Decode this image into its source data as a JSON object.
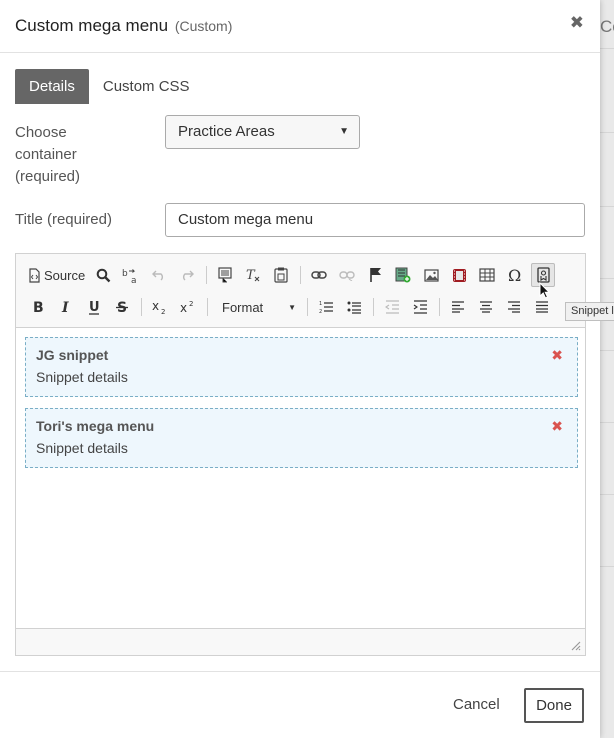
{
  "background": {
    "text": "Co"
  },
  "modal": {
    "title": "Custom mega menu",
    "subtitle": "(Custom)",
    "close": "✖"
  },
  "tabs": [
    {
      "label": "Details",
      "active": true
    },
    {
      "label": "Custom CSS",
      "active": false
    }
  ],
  "form": {
    "container_label_1": "Choose",
    "container_label_2": "container",
    "container_label_3": "(required)",
    "container_value": "Practice Areas",
    "title_label": "Title (required)",
    "title_value": "Custom mega menu"
  },
  "toolbar": {
    "source_label": "Source",
    "format_label": "Format",
    "tooltip": "Snippet link"
  },
  "snippets": [
    {
      "title": "JG snippet",
      "details": "Snippet details",
      "remove": "✖"
    },
    {
      "title": "Tori's mega menu",
      "details": "Snippet details",
      "remove": "✖"
    }
  ],
  "footer": {
    "cancel": "Cancel",
    "done": "Done"
  },
  "colors": {
    "active_tab": "#666666",
    "snippet_border": "#7aaec6",
    "snippet_bg": "#eef7fd",
    "remove": "#d9534f"
  },
  "icons": [
    "source-icon",
    "find-icon",
    "replace-icon",
    "undo-icon",
    "redo-icon",
    "paste-text-icon",
    "remove-format-icon",
    "paste-word-icon",
    "link-icon",
    "unlink-icon",
    "anchor-icon",
    "media-icon",
    "image-icon",
    "video-icon",
    "table-icon",
    "omega-icon",
    "snippet-link-icon",
    "bold-icon",
    "italic-icon",
    "underline-icon",
    "strike-icon",
    "subscript-icon",
    "superscript-icon",
    "numbered-list-icon",
    "bulleted-list-icon",
    "outdent-icon",
    "indent-icon",
    "align-left-icon",
    "align-center-icon",
    "align-right-icon",
    "justify-icon"
  ]
}
